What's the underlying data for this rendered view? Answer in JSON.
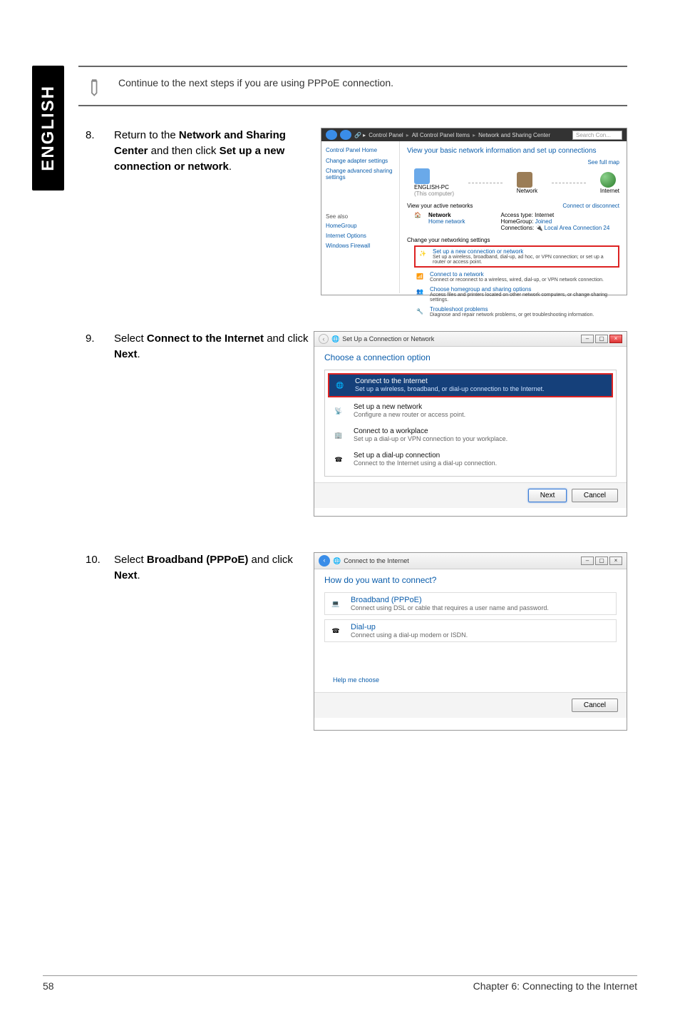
{
  "side_label": "ENGLISH",
  "note": "Continue to the next steps if you are using PPPoE connection.",
  "steps": {
    "8": {
      "num": "8.",
      "body_pre": "Return to the ",
      "bold1": "Network and Sharing Center",
      "body_mid": " and then click ",
      "bold2": "Set up a new connection or network",
      "body_post": "."
    },
    "9": {
      "num": "9.",
      "body_pre": "Select ",
      "bold1": "Connect to the Internet",
      "body_mid": " and click ",
      "bold2": "Next",
      "body_post": "."
    },
    "10": {
      "num": "10.",
      "body_pre": "Select ",
      "bold1": "Broadband (PPPoE)",
      "body_mid": " and click ",
      "bold2": "Next",
      "body_post": "."
    }
  },
  "screenshot1": {
    "breadcrumb": {
      "a": "Control Panel",
      "b": "All Control Panel Items",
      "c": "Network and Sharing Center"
    },
    "search_placeholder": "Search Con...",
    "side": {
      "home": "Control Panel Home",
      "link1": "Change adapter settings",
      "link2": "Change advanced sharing settings",
      "also": "See also",
      "also1": "HomeGroup",
      "also2": "Internet Options",
      "also3": "Windows Firewall"
    },
    "main": {
      "title": "View your basic network information and set up connections",
      "full_map": "See full map",
      "map": {
        "pc": "ENGLISH-PC",
        "pc_sub": "(This computer)",
        "net": "Network",
        "int": "Internet"
      },
      "active_head": "View your active networks",
      "conn_disc": "Connect or disconnect",
      "network_name": "Network",
      "network_type": "Home network",
      "access_type": "Access type:",
      "access_val": "Internet",
      "homegroup": "HomeGroup:",
      "homegroup_val": "Joined",
      "connections": "Connections:",
      "connections_val": "Local Area Connection 24",
      "change_head": "Change your networking settings",
      "task1_t": "Set up a new connection or network",
      "task1_s": "Set up a wireless, broadband, dial-up, ad hoc, or VPN connection; or set up a router or access point.",
      "task2_t": "Connect to a network",
      "task2_s": "Connect or reconnect to a wireless, wired, dial-up, or VPN network connection.",
      "task3_t": "Choose homegroup and sharing options",
      "task3_s": "Access files and printers located on other network computers, or change sharing settings.",
      "task4_t": "Troubleshoot problems",
      "task4_s": "Diagnose and repair network problems, or get troubleshooting information."
    }
  },
  "screenshot2": {
    "title": "Set Up a Connection or Network",
    "heading": "Choose a connection option",
    "opt1_t": "Connect to the Internet",
    "opt1_s": "Set up a wireless, broadband, or dial-up connection to the Internet.",
    "opt2_t": "Set up a new network",
    "opt2_s": "Configure a new router or access point.",
    "opt3_t": "Connect to a workplace",
    "opt3_s": "Set up a dial-up or VPN connection to your workplace.",
    "opt4_t": "Set up a dial-up connection",
    "opt4_s": "Connect to the Internet using a dial-up connection.",
    "next": "Next",
    "cancel": "Cancel"
  },
  "screenshot3": {
    "title": "Connect to the Internet",
    "heading": "How do you want to connect?",
    "opt1_t": "Broadband (PPPoE)",
    "opt1_s": "Connect using DSL or cable that requires a user name and password.",
    "opt2_t": "Dial-up",
    "opt2_s": "Connect using a dial-up modem or ISDN.",
    "help": "Help me choose",
    "cancel": "Cancel"
  },
  "footer": {
    "page": "58",
    "chapter": "Chapter 6: Connecting to the Internet"
  }
}
